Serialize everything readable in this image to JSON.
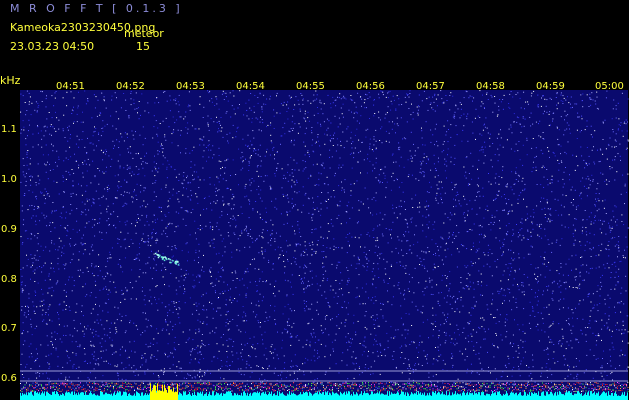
{
  "header": {
    "app_title": "M R O F F T  [ 0.1.3 ]",
    "file_name": "Kameoka2303230450.png",
    "date_time": "23.03.23  04:50",
    "meteor_label": "meteor",
    "meteor_count": "15"
  },
  "spectrogram": {
    "frequency_unit": "kHz",
    "time_ticks": [
      "04:51",
      "04:52",
      "04:53",
      "04:54",
      "04:55",
      "04:56",
      "04:57",
      "04:58",
      "04:59",
      "05:00"
    ],
    "frequency_ticks": [
      "1.1",
      "1.0",
      "0.9",
      "0.8",
      "0.7",
      "0.6"
    ],
    "colors": {
      "background": "#000000",
      "plot_background": "#0a0a6e",
      "text": "#ffff3c",
      "title": "#8c8cd8",
      "noise_floor": "#00ffff",
      "burst": "#ffff00"
    }
  }
}
